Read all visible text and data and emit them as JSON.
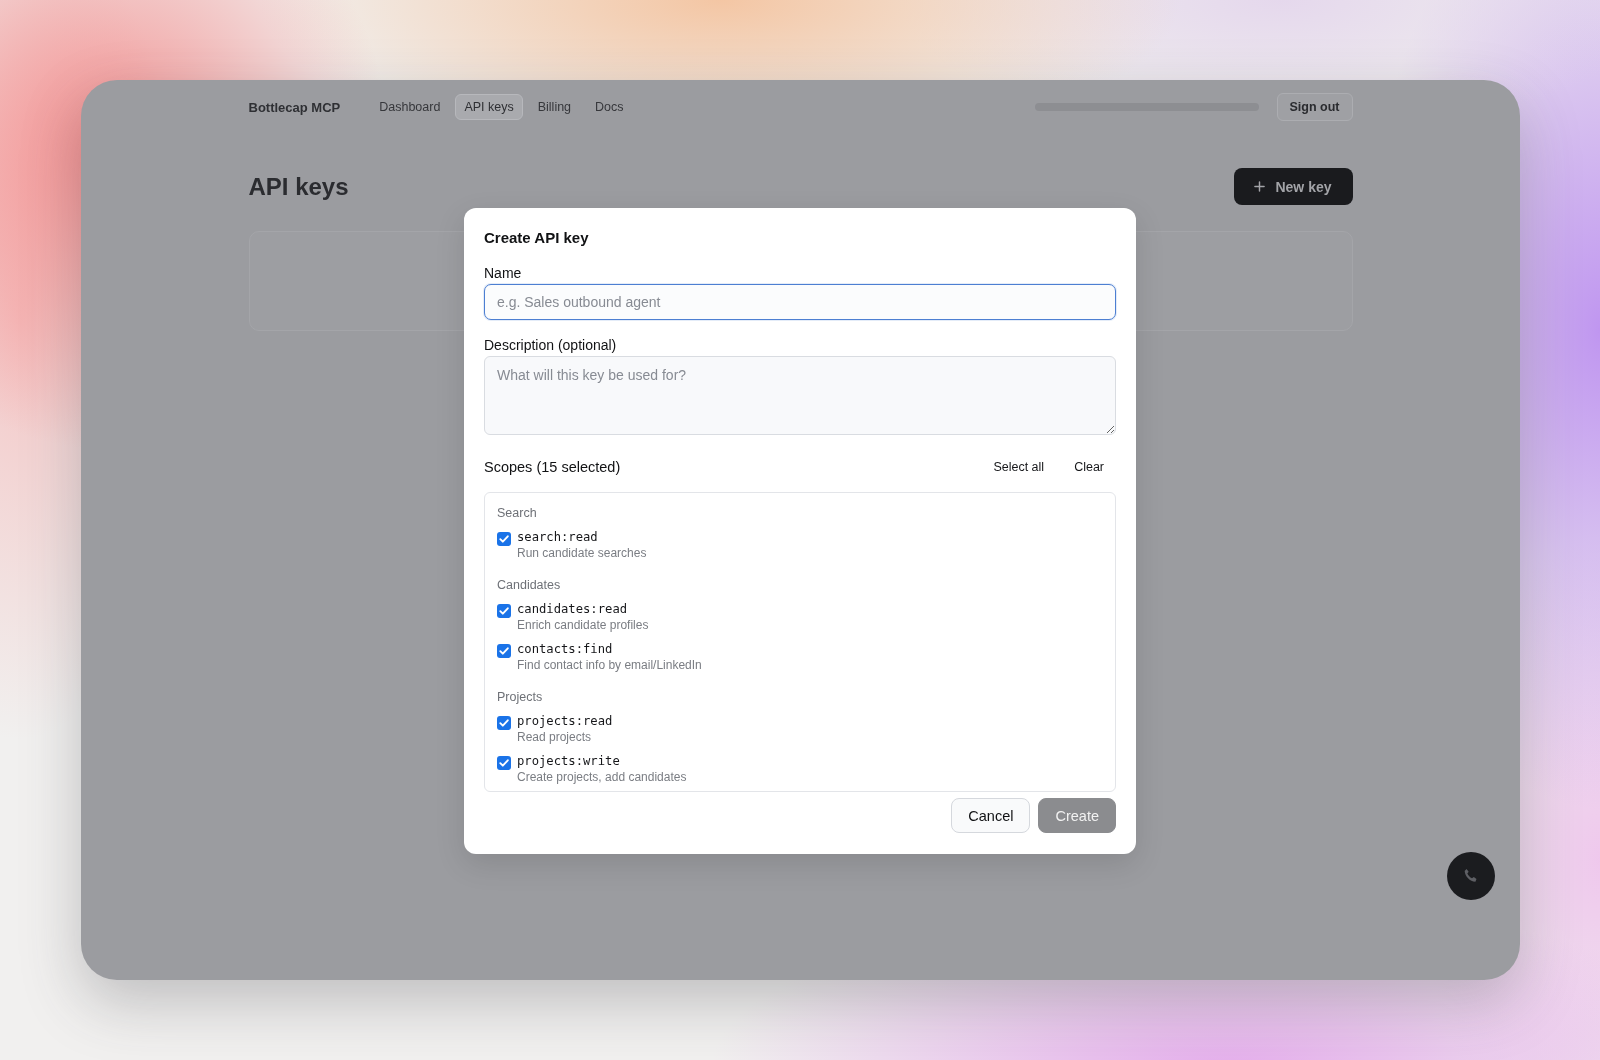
{
  "app": {
    "brand": "Bottlecap MCP",
    "nav": [
      {
        "label": "Dashboard",
        "selected": false
      },
      {
        "label": "API keys",
        "selected": true
      },
      {
        "label": "Billing",
        "selected": false
      },
      {
        "label": "Docs",
        "selected": false
      }
    ],
    "sign_out": "Sign out",
    "page_title": "API keys",
    "new_key_button": "New key"
  },
  "dialog": {
    "title": "Create API key",
    "fields": [
      {
        "kind": "input",
        "label": "Name",
        "placeholder": "e.g. Sales outbound agent",
        "focused": true
      },
      {
        "kind": "textarea",
        "label": "Description (optional)",
        "placeholder": "What will this key be used for?",
        "focused": false
      }
    ],
    "scopes": {
      "heading": "Scopes (15 selected)",
      "actions": [
        "Select all",
        "Clear"
      ],
      "groups": [
        {
          "name": "Search",
          "items": [
            {
              "scope": "search:read",
              "description": "Run candidate searches",
              "checked": true
            }
          ]
        },
        {
          "name": "Candidates",
          "items": [
            {
              "scope": "candidates:read",
              "description": "Enrich candidate profiles",
              "checked": true
            },
            {
              "scope": "contacts:find",
              "description": "Find contact info by email/LinkedIn",
              "checked": true
            }
          ]
        },
        {
          "name": "Projects",
          "items": [
            {
              "scope": "projects:read",
              "description": "Read projects",
              "checked": true
            },
            {
              "scope": "projects:write",
              "description": "Create projects, add candidates",
              "checked": true
            }
          ]
        }
      ]
    },
    "buttons": [
      {
        "kind": "secondary",
        "label": "Cancel",
        "disabled": false
      },
      {
        "kind": "primary",
        "label": "Create",
        "disabled": true
      }
    ]
  }
}
